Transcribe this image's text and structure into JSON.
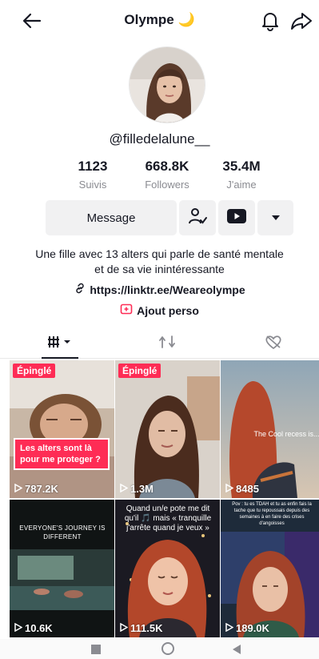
{
  "header": {
    "title": "Olympe 🌙"
  },
  "profile": {
    "username": "@filledelalune__",
    "stats": [
      {
        "value": "1123",
        "label": "Suivis"
      },
      {
        "value": "668.8K",
        "label": "Followers"
      },
      {
        "value": "35.4M",
        "label": "J'aime"
      }
    ],
    "message_label": "Message",
    "bio": "Une fille avec 13 alters qui parle de santé mentale et de sa vie inintéressante",
    "link": "https://linktr.ee/Weareolympe",
    "add_yours": "Ajout perso"
  },
  "videos": [
    {
      "views": "787.2K",
      "pinned": "Épinglé",
      "caption": "Les alters sont là pour me proteger ?"
    },
    {
      "views": "1.3M",
      "pinned": "Épinglé"
    },
    {
      "views": "8485",
      "caption": "The Cool recess is..."
    },
    {
      "views": "10.6K",
      "caption": "EVERYONE'S JOURNEY IS DIFFERENT"
    },
    {
      "views": "111.5K",
      "caption": "Quand un/e pote me dit qu'il 🎵 mais « tranquille j'arrête quand je veux »"
    },
    {
      "views": "189.0K",
      "caption": "Pov : tu es TDAH et tu as enfin fais la tache que tu repoussais depuis des semaines à en faire des crises d'angoisses"
    }
  ],
  "colors": {
    "accent": "#fe2c55",
    "text": "#161823",
    "muted": "#8a8b91",
    "button_bg": "#f1f1f2"
  }
}
